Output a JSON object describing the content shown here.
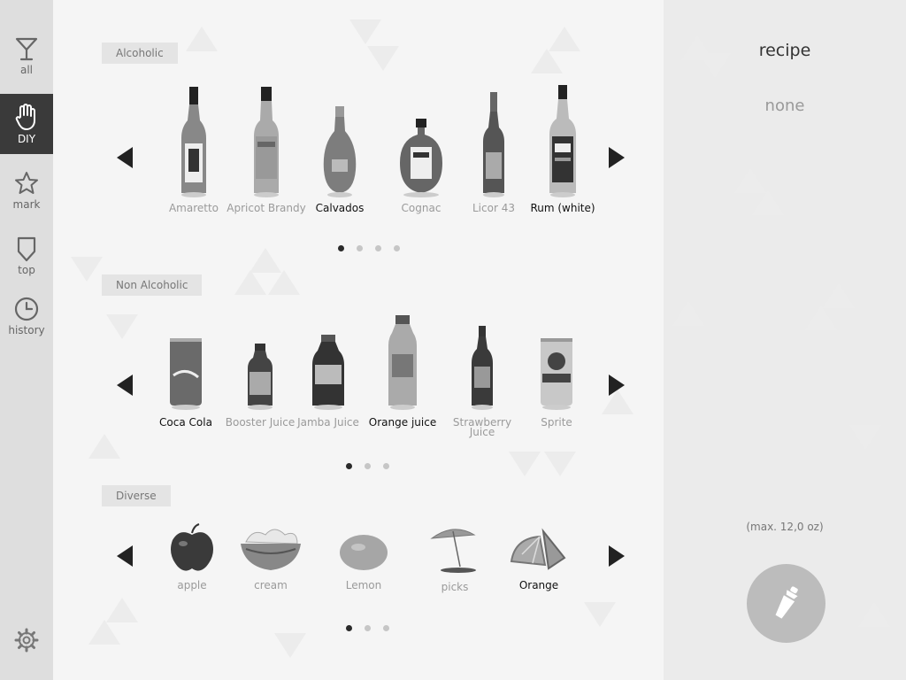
{
  "nav": {
    "items": [
      {
        "label": "all",
        "icon": "cocktail-glass-icon"
      },
      {
        "label": "DIY",
        "icon": "hand-icon"
      },
      {
        "label": "mark",
        "icon": "star-icon"
      },
      {
        "label": "top",
        "icon": "shield-icon"
      },
      {
        "label": "history",
        "icon": "clock-icon"
      }
    ],
    "active": "DIY",
    "settings_icon": "gear-icon"
  },
  "sections": [
    {
      "label": "Alcoholic",
      "items": [
        {
          "name": "Amaretto",
          "selected": false
        },
        {
          "name": "Apricot Brandy",
          "selected": false
        },
        {
          "name": "Calvados",
          "selected": true
        },
        {
          "name": "Cognac",
          "selected": false
        },
        {
          "name": "Licor 43",
          "selected": false
        },
        {
          "name": "Rum (white)",
          "selected": true
        }
      ],
      "pages": 4,
      "current_page": 1
    },
    {
      "label": "Non Alcoholic",
      "items": [
        {
          "name": "Coca Cola",
          "selected": true
        },
        {
          "name": "Booster Juice",
          "selected": false
        },
        {
          "name": "Jamba Juice",
          "selected": false
        },
        {
          "name": "Orange juice",
          "selected": true
        },
        {
          "name": "Strawberry Juice",
          "selected": false
        },
        {
          "name": "Sprite",
          "selected": false
        }
      ],
      "pages": 3,
      "current_page": 1
    },
    {
      "label": "Diverse",
      "items": [
        {
          "name": "apple",
          "selected": false
        },
        {
          "name": "cream",
          "selected": false
        },
        {
          "name": "Lemon",
          "selected": false
        },
        {
          "name": "picks",
          "selected": false
        },
        {
          "name": "Orange",
          "selected": true
        }
      ],
      "pages": 3,
      "current_page": 1
    }
  ],
  "recipe": {
    "title": "recipe",
    "content": "none",
    "capacity": "(max. 12,0 oz)",
    "action_icon": "cocktail-shaker-icon"
  },
  "colors": {
    "sidebar_bg": "#dedede",
    "sidebar_active": "#3a3a3a",
    "selected_text": "#111111",
    "unselected_text": "#9a9a9a",
    "shake_button": "#bcbcbc"
  }
}
